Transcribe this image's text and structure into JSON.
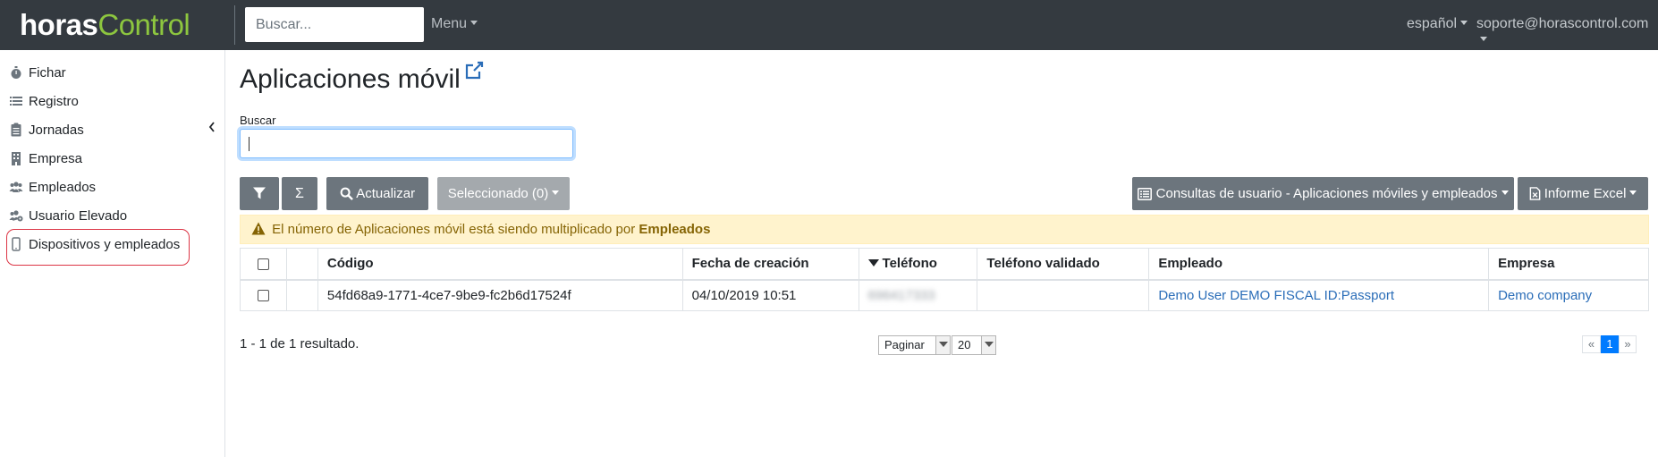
{
  "brand": {
    "part1": "horas",
    "part2": "Control"
  },
  "navbar": {
    "search_placeholder": "Buscar...",
    "menu_label": "Menu",
    "language_label": "español",
    "user_label": "soporte@horascontrol.com"
  },
  "sidebar": {
    "items": [
      {
        "label": "Fichar",
        "icon": "stopwatch-icon"
      },
      {
        "label": "Registro",
        "icon": "list-icon"
      },
      {
        "label": "Jornadas",
        "icon": "clipboard-icon"
      },
      {
        "label": "Empresa",
        "icon": "building-icon"
      },
      {
        "label": "Empleados",
        "icon": "users-icon"
      },
      {
        "label": "Usuario Elevado",
        "icon": "users-cog-icon"
      },
      {
        "label": "Dispositivos y empleados",
        "icon": "mobile-icon",
        "highlighted": true
      }
    ],
    "highlight_color": "#dc3545"
  },
  "main": {
    "title": "Aplicaciones móvil",
    "search_label": "Buscar",
    "search_value": "",
    "toolbar": {
      "refresh_label": "Actualizar",
      "sum_symbol": "Σ",
      "selected_label": "Seleccionado (0)",
      "queries_label": "Consultas de usuario - Aplicaciones móviles y empleados",
      "excel_label": "Informe Excel"
    },
    "alert": {
      "text_before": "El número de Aplicaciones móvil está siendo multiplicado por",
      "bold": "Empleados"
    },
    "table": {
      "columns": [
        "Código",
        "Fecha de creación",
        "Teléfono",
        "Teléfono validado",
        "Empleado",
        "Empresa"
      ],
      "sorted_column": "Teléfono",
      "rows": [
        {
          "code": "54fd68a9-1771-4ce7-9be9-fc2b6d17524f",
          "created": "04/10/2019 10:51",
          "phone": "696417333",
          "phone_validated": "",
          "employee": "Demo User DEMO FISCAL ID:Passport",
          "company": "Demo company"
        }
      ]
    },
    "footer": {
      "result_text": "1 - 1 de 1 resultado.",
      "paginate_label": "Paginar",
      "page_size": "20",
      "prev": "«",
      "current_page": "1",
      "next": "»"
    }
  },
  "colors": {
    "navbar_bg": "#343a40",
    "brand_green": "#8dc63f",
    "button_dark": "#6c757d",
    "alert_bg": "#fff3cd",
    "link": "#2a6db8"
  }
}
